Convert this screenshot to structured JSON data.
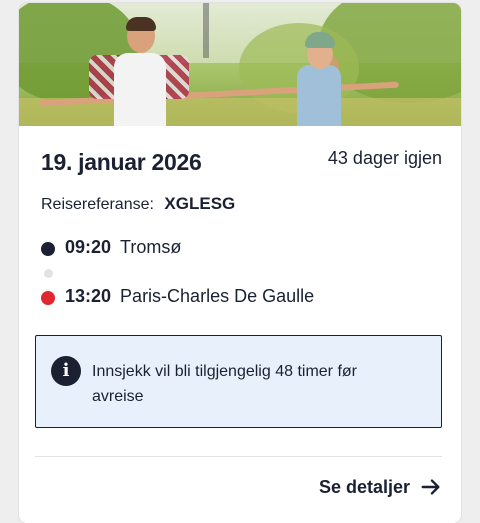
{
  "trip": {
    "date": "19. januar 2026",
    "days_left": "43 dager igjen",
    "reference_label": "Reisereferanse:",
    "reference_code": "XGLESG",
    "departure": {
      "time": "09:20",
      "place": "Tromsø"
    },
    "arrival": {
      "time": "13:20",
      "place": "Paris-Charles De Gaulle"
    }
  },
  "info": {
    "icon": "info-icon",
    "text": "Innsjekk vil bli tilgjengelig 48 timer før avreise"
  },
  "footer": {
    "details_label": "Se detaljer",
    "details_icon": "arrow-right-icon"
  },
  "colors": {
    "text": "#1b2133",
    "departure_dot": "#1b2133",
    "arrival_dot": "#e0262f",
    "info_bg": "#e7f0fb"
  }
}
